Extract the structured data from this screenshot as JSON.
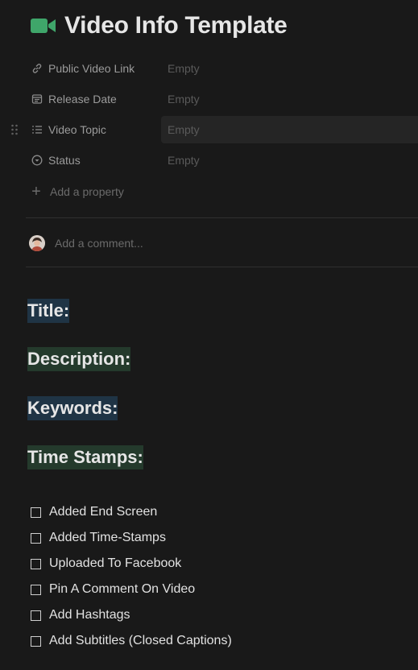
{
  "page": {
    "title": "Video Info Template",
    "icon": "video-camera-icon"
  },
  "properties": [
    {
      "icon": "link-icon",
      "label": "Public Video Link",
      "value": "Empty"
    },
    {
      "icon": "calendar-icon",
      "label": "Release Date",
      "value": "Empty"
    },
    {
      "icon": "list-icon",
      "label": "Video Topic",
      "value": "Empty"
    },
    {
      "icon": "status-icon",
      "label": "Status",
      "value": "Empty"
    }
  ],
  "add_property": {
    "label": "Add a property"
  },
  "comment": {
    "placeholder": "Add a comment..."
  },
  "headings": [
    {
      "text": "Title:",
      "color": "#1f3445"
    },
    {
      "text": "Description:",
      "color": "#243a2c"
    },
    {
      "text": "Keywords:",
      "color": "#1f3445"
    },
    {
      "text": "Time Stamps:",
      "color": "#243a2c"
    }
  ],
  "todos": [
    {
      "label": "Added End Screen",
      "checked": false
    },
    {
      "label": "Added Time-Stamps",
      "checked": false
    },
    {
      "label": "Uploaded To Facebook",
      "checked": false
    },
    {
      "label": "Pin A Comment On Video",
      "checked": false
    },
    {
      "label": "Add Hashtags",
      "checked": false
    },
    {
      "label": "Add Subtitles (Closed Captions)",
      "checked": false
    }
  ],
  "colors": {
    "background": "#191919",
    "accent_green": "#3fa66a"
  }
}
